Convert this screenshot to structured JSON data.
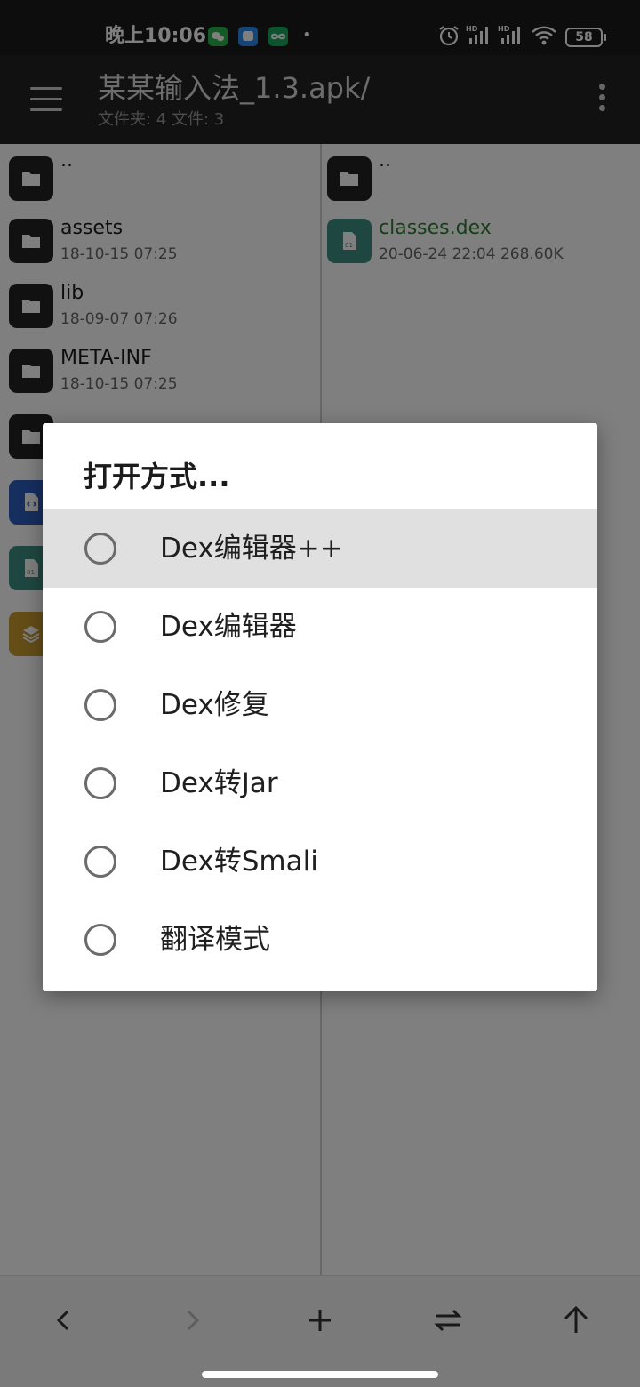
{
  "status_bar": {
    "time": "晚上10:06",
    "notification_icons": [
      "wechat-icon",
      "messenger-icon",
      "infinity-app-icon"
    ],
    "battery": "58",
    "indicators": [
      "alarm-icon",
      "hd-signal-icon",
      "hd-signal-icon",
      "wifi-icon"
    ]
  },
  "app_bar": {
    "title": "某某输入法_1.3.apk/",
    "subtitle": "文件夹: 4  文件: 3"
  },
  "left_pane": {
    "items": [
      {
        "name": "..",
        "meta": "",
        "icon": "folder-icon"
      },
      {
        "name": "assets",
        "meta": "18-10-15 07:25",
        "icon": "folder-icon"
      },
      {
        "name": "lib",
        "meta": "18-09-07 07:26",
        "icon": "folder-icon"
      },
      {
        "name": "META-INF",
        "meta": "18-10-15 07:25",
        "icon": "folder-icon"
      },
      {
        "name": "",
        "meta": "",
        "icon": "folder-icon"
      },
      {
        "name": "",
        "meta": "",
        "icon": "xml-file-icon"
      },
      {
        "name": "",
        "meta": "",
        "icon": "dex-file-icon"
      },
      {
        "name": "",
        "meta": "",
        "icon": "layers-file-icon"
      }
    ]
  },
  "right_pane": {
    "items": [
      {
        "name": "..",
        "meta": "",
        "icon": "folder-icon"
      },
      {
        "name": "classes.dex",
        "meta": "20-06-24 22:04  268.60K",
        "icon": "dex-file-icon"
      }
    ]
  },
  "dialog": {
    "title": "打开方式...",
    "options": [
      {
        "label": "Dex编辑器++",
        "highlighted": true
      },
      {
        "label": "Dex编辑器",
        "highlighted": false
      },
      {
        "label": "Dex修复",
        "highlighted": false
      },
      {
        "label": "Dex转Jar",
        "highlighted": false
      },
      {
        "label": "Dex转Smali",
        "highlighted": false
      },
      {
        "label": "翻译模式",
        "highlighted": false
      }
    ]
  },
  "bottom_bar": {
    "buttons": [
      "back-arrow-icon",
      "forward-arrow-icon",
      "add-icon",
      "swap-icon",
      "up-arrow-icon"
    ]
  },
  "colors": {
    "app_bar_bg": "#232323",
    "status_bar_bg": "#1b1b1b",
    "dex_file_name": "#2e7d32",
    "dex_icon_bg": "#3e8e82",
    "xml_icon_bg": "#2d5fbf",
    "layers_icon_bg": "#c99a2e",
    "dialog_highlight": "#e0e0e0"
  }
}
